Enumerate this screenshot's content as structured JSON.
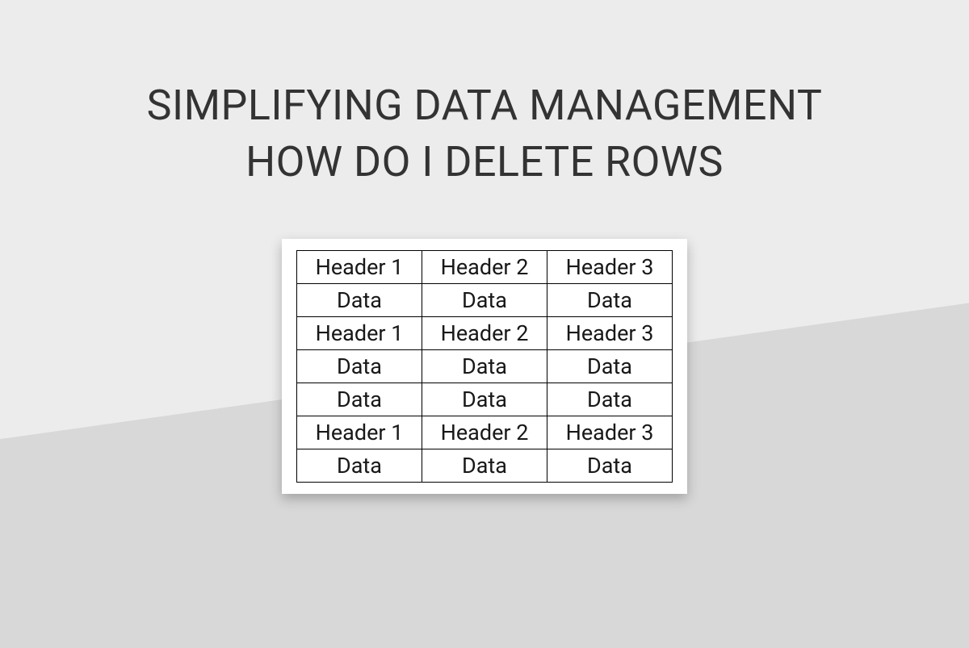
{
  "title": {
    "line1": "SIMPLIFYING DATA MANAGEMENT",
    "line2": "HOW DO I DELETE ROWS"
  },
  "table": {
    "rows": [
      [
        "Header 1",
        "Header 2",
        "Header 3"
      ],
      [
        "Data",
        "Data",
        "Data"
      ],
      [
        "Header 1",
        "Header 2",
        "Header 3"
      ],
      [
        "Data",
        "Data",
        "Data"
      ],
      [
        "Data",
        "Data",
        "Data"
      ],
      [
        "Header 1",
        "Header 2",
        "Header 3"
      ],
      [
        "Data",
        "Data",
        "Data"
      ]
    ]
  }
}
